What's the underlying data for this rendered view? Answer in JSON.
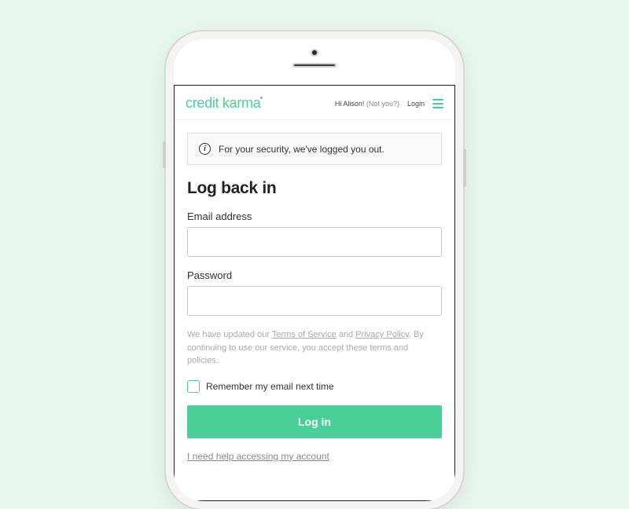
{
  "logo": "credit karma",
  "topbar": {
    "greeting": "Hi Alison!",
    "not_you": "(Not you?)",
    "login": "Login"
  },
  "notice": "For your security, we've logged you out.",
  "heading": "Log back in",
  "fields": {
    "email_label": "Email address",
    "password_label": "Password"
  },
  "legal": {
    "prefix": "We have updated our ",
    "tos": "Terms of Service",
    "mid": " and ",
    "privacy": "Privacy Policy",
    "suffix": ". By continuing to use our service, you accept these terms and policies."
  },
  "remember_label": "Remember my email next time",
  "login_button": "Log in",
  "help_link": "I need help accessing my account"
}
